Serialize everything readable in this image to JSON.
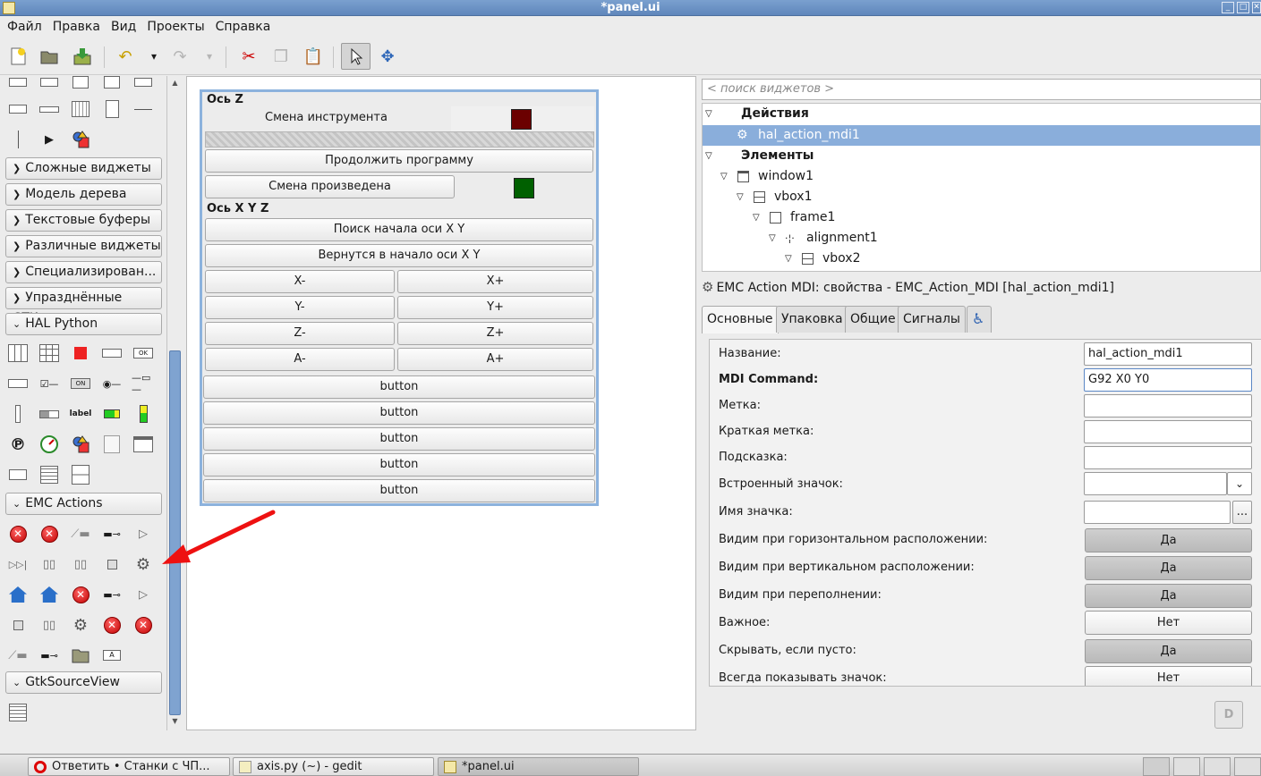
{
  "window": {
    "title": "*panel.ui",
    "controls": [
      "_",
      "□",
      "✕"
    ]
  },
  "menu": [
    "Файл",
    "Правка",
    "Вид",
    "Проекты",
    "Справка"
  ],
  "toolbar_icons": [
    "new-icon",
    "open-icon",
    "save-icon",
    "undo-icon",
    "undo-dropdown-icon",
    "redo-icon",
    "redo-dropdown-icon",
    "cut-icon",
    "copy-icon",
    "paste-icon",
    "pointer-icon",
    "drag-resize-icon"
  ],
  "palette": {
    "groups": {
      "complex": "Сложные виджеты",
      "tree_model": "Модель дерева",
      "text_buffers": "Текстовые буферы",
      "misc": "Различные виджеты",
      "special": "Специализирован...",
      "deprecated": "Упразднённые GTK+",
      "hal_python": "HAL Python",
      "emc_actions": "EMC Actions",
      "gtksourceview": "GtkSourceView"
    },
    "small_text": {
      "label": "label",
      "ok": "OK",
      "on": "ON",
      "a": "A"
    }
  },
  "canvas": {
    "frame_z": "Ось Z",
    "tool_change": "Смена инструмента",
    "tool_indicator_color": "#6b0000",
    "continue_program": "Продолжить программу",
    "change_done": "Смена произведена",
    "done_indicator_color": "#006000",
    "frame_xyz": "Ось X Y Z",
    "search_home": "Поиск начала оси X Y",
    "return_home": "Вернутся в начало оси X Y",
    "jog": [
      [
        "X-",
        "X+"
      ],
      [
        "Y-",
        "Y+"
      ],
      [
        "Z-",
        "Z+"
      ],
      [
        "A-",
        "A+"
      ]
    ],
    "buttons": [
      "button",
      "button",
      "button",
      "button",
      "button"
    ]
  },
  "inspector": {
    "search_placeholder": "< поиск виджетов >",
    "tree": [
      {
        "label": "Действия",
        "bold": true
      },
      {
        "label": "hal_action_mdi1",
        "selected": true
      },
      {
        "label": "Элементы",
        "bold": true
      },
      {
        "label": "window1"
      },
      {
        "label": "vbox1"
      },
      {
        "label": "frame1"
      },
      {
        "label": "alignment1"
      },
      {
        "label": "vbox2"
      }
    ]
  },
  "properties": {
    "header": "EMC Action MDI: свойства - EMC_Action_MDI [hal_action_mdi1]",
    "tabs": [
      "Основные",
      "Упаковка",
      "Общие",
      "Сигналы"
    ],
    "name_label": "Название:",
    "name_value": "hal_action_mdi1",
    "mdi_label": "MDI Command:",
    "mdi_value": "G92  X0  Y0",
    "label_label": "Метка:",
    "short_label": "Краткая метка:",
    "tooltip_label": "Подсказка:",
    "stock_icon_label": "Встроенный значок:",
    "icon_name_label": "Имя значка:",
    "browse": "...",
    "vis_h_label": "Видим при горизонтальном расположении:",
    "vis_h_value": "Да",
    "vis_v_label": "Видим при вертикальном расположении:",
    "vis_v_value": "Да",
    "vis_overflow_label": "Видим при переполнении:",
    "vis_overflow_value": "Да",
    "important_label": "Важное:",
    "important_value": "Нет",
    "hide_empty_label": "Скрывать, если пусто:",
    "hide_empty_value": "Да",
    "always_icon_label": "Всегда показывать значок:",
    "always_icon_value": "Нет"
  },
  "taskbar": [
    {
      "label": "Ответить • Станки с ЧП..."
    },
    {
      "label": "axis.py (~) - gedit"
    },
    {
      "label": "*panel.ui"
    }
  ]
}
